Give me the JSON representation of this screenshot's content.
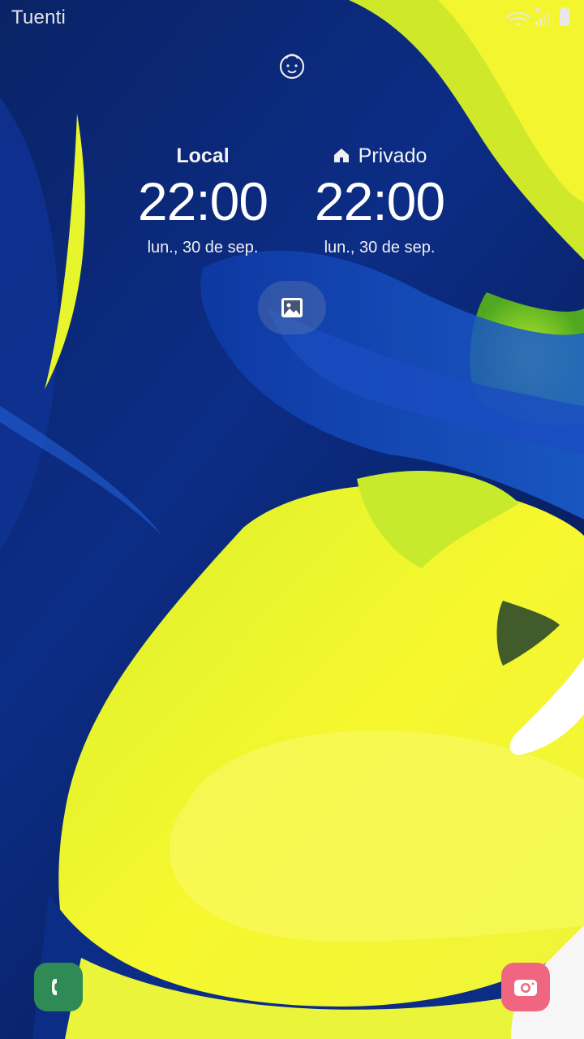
{
  "status_bar": {
    "carrier": "Tuenti",
    "roaming_indicator": "R",
    "icons": [
      "wifi-icon",
      "signal-icon",
      "battery-icon"
    ]
  },
  "lock_screen": {
    "owner_icon": "face-icon",
    "clocks": {
      "local": {
        "label": "Local",
        "time": "22:00",
        "date": "lun., 30 de sep."
      },
      "home": {
        "label": "Privado",
        "icon": "home-icon",
        "time": "22:00",
        "date": "lun., 30 de sep."
      }
    },
    "wallpaper_button_icon": "image-icon"
  },
  "shortcuts": {
    "left": {
      "icon": "phone-icon",
      "color": "#2f8a55"
    },
    "right": {
      "icon": "camera-icon",
      "color": "#f06681"
    }
  },
  "colors": {
    "wallpaper_blue": "#0b2a7a",
    "wallpaper_yellow": "#f4f62a",
    "wallpaper_green": "#7bd82a"
  }
}
